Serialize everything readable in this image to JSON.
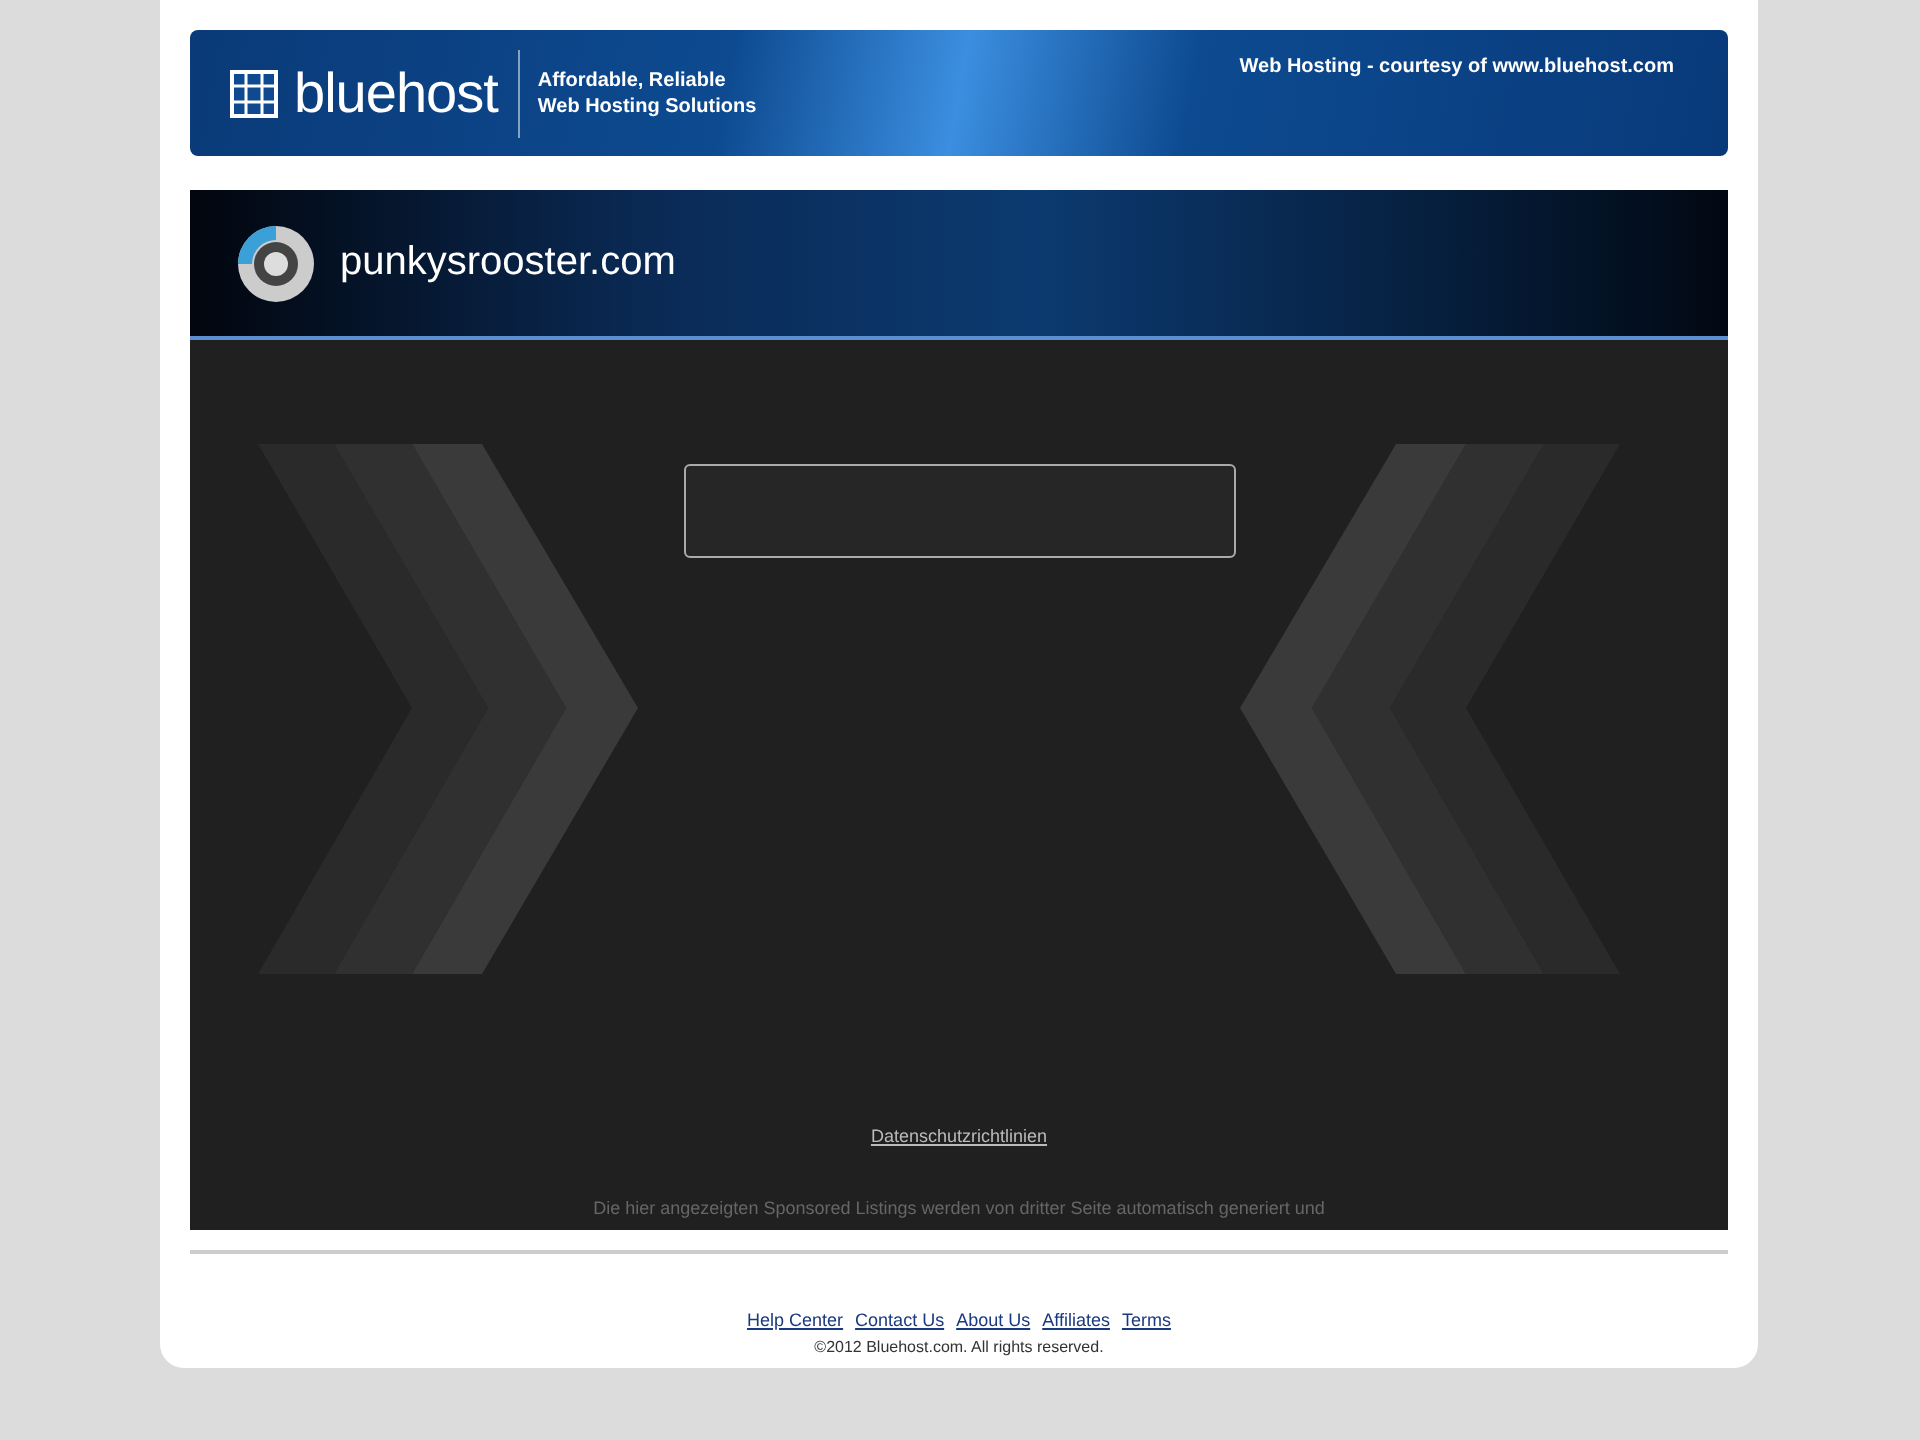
{
  "banner": {
    "logo": "bluehost",
    "tagline_1": "Affordable, Reliable",
    "tagline_2": "Web Hosting Solutions",
    "courtesy": "Web Hosting - courtesy of www.bluehost.com"
  },
  "site": {
    "domain": "punkysrooster.com"
  },
  "privacy_link": "Datenschutzrichtlinien",
  "disclaimer": "Die hier angezeigten Sponsored Listings werden von dritter Seite automatisch generiert und",
  "footer": {
    "links": [
      "Help Center",
      "Contact Us",
      "About Us",
      "Affiliates",
      "Terms"
    ],
    "copyright": "©2012 Bluehost.com. All rights reserved."
  }
}
